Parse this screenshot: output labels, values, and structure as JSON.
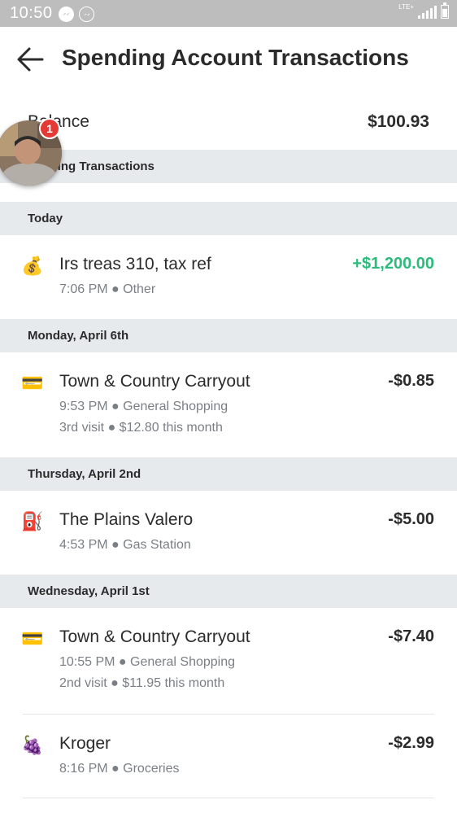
{
  "status_bar": {
    "time": "10:50",
    "left_icons": [
      "messenger-icon",
      "messenger-outline-icon"
    ],
    "lte_text": "LTE+",
    "right_icons": [
      "signal-icon",
      "battery-icon"
    ]
  },
  "header": {
    "title": "Spending Account Transactions",
    "back_icon": "back-arrow-icon"
  },
  "balance": {
    "label": "Balance",
    "value": "$100.93"
  },
  "pending": {
    "label": "Pending Transactions"
  },
  "sections": [
    {
      "date": "Today",
      "transactions": [
        {
          "icon": "money-bag-icon",
          "emoji": "💰",
          "merchant": "Irs treas 310, tax ref",
          "amount": "+$1,200.00",
          "meta1": "7:06 PM ● Other"
        }
      ]
    },
    {
      "date": "Monday, April 6th",
      "transactions": [
        {
          "icon": "credit-card-icon",
          "emoji": "💳",
          "merchant": "Town & Country Carryout",
          "amount": "-$0.85",
          "meta1": "9:53 PM ● General Shopping",
          "meta2": "3rd visit ● $12.80 this month"
        }
      ]
    },
    {
      "date": "Thursday, April 2nd",
      "transactions": [
        {
          "icon": "fuel-pump-icon",
          "emoji": "⛽",
          "merchant": "The Plains Valero",
          "amount": "-$5.00",
          "meta1": "4:53 PM ● Gas Station"
        }
      ]
    },
    {
      "date": "Wednesday, April 1st",
      "transactions": [
        {
          "icon": "credit-card-icon",
          "emoji": "💳",
          "merchant": "Town & Country Carryout",
          "amount": "-$7.40",
          "meta1": "10:55 PM ● General Shopping",
          "meta2": "2nd visit ● $11.95 this month"
        },
        {
          "icon": "grapes-icon",
          "emoji": "🍇",
          "merchant": "Kroger",
          "amount": "-$2.99",
          "meta1": "8:16 PM ● Groceries"
        }
      ]
    }
  ],
  "chathead": {
    "badge": "1"
  },
  "colors": {
    "status_bar": "#bdbdbd",
    "section_bg": "#e7eaed",
    "positive_amount": "#2dbb7c",
    "meta_text": "#7a7f85",
    "badge": "#e53935"
  }
}
